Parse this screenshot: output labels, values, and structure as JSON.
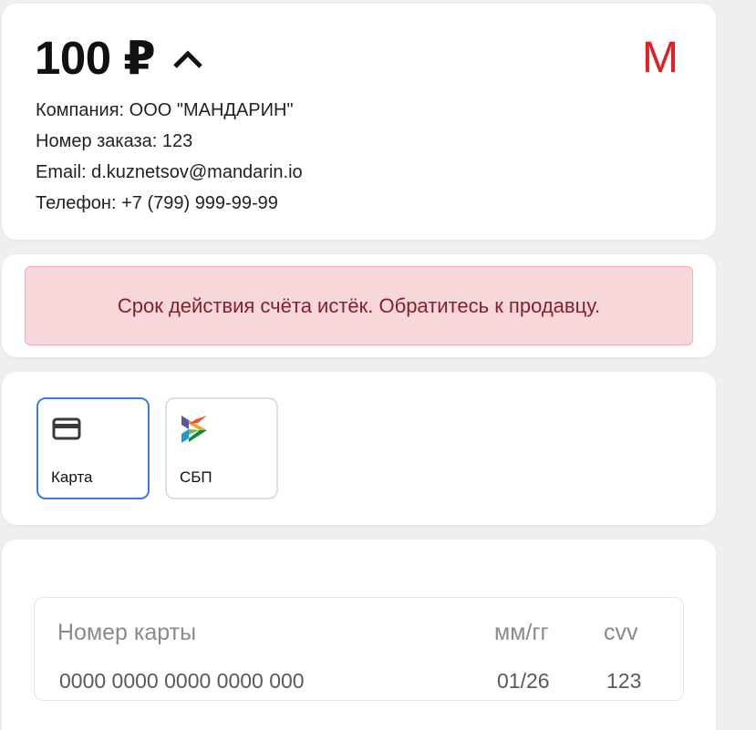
{
  "order": {
    "amount": "100 ₽",
    "logo_letter": "M",
    "company": "Компания: ООО \"МАНДАРИН\"",
    "order_number": "Номер заказа: 123",
    "email": "Email: d.kuznetsov@mandarin.io",
    "phone": "Телефон: +7 (799) 999-99-99"
  },
  "alert": {
    "text": "Срок действия счёта истёк. Обратитесь к продавцу."
  },
  "payment_methods": [
    {
      "label": "Карта",
      "icon": "credit-card-icon",
      "selected": true
    },
    {
      "label": "СБП",
      "icon": "sbp-logo-icon",
      "selected": false
    }
  ],
  "card_form": {
    "number_label": "Номер карты",
    "number_placeholder": "0000 0000 0000 0000 000",
    "expiry_label": "мм/гг",
    "expiry_placeholder": "01/26",
    "cvv_label": "cvv",
    "cvv_placeholder": "123"
  },
  "colors": {
    "brand": "#e21f26",
    "alert_bg": "#f8d7da",
    "alert_text": "#842029",
    "selected_border": "#3b7ddd"
  }
}
